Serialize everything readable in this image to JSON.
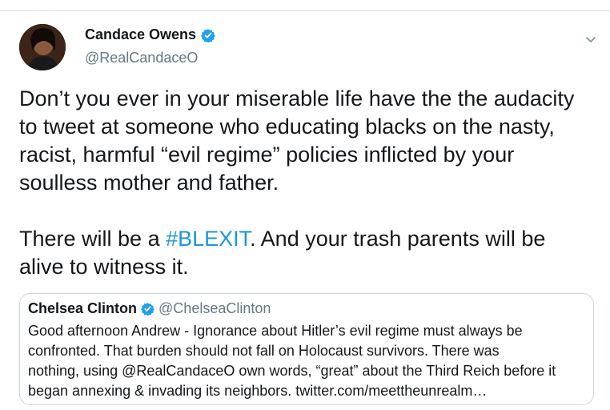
{
  "tweet": {
    "author_name": "Candace Owens",
    "author_handle": "@RealCandaceO",
    "body_lines": [
      "Don’t you ever in your miserable life have the the audacity",
      "to tweet at someone who educating blacks on the nasty,",
      "racist, harmful “evil regime” policies inflicted by your",
      "soulless mother and father."
    ],
    "second_para_line1_pre": "There will be a ",
    "hashtag": "#BLEXIT",
    "second_para_line1_post": ". And your trash parents will be",
    "second_para_line2": "alive to witness it."
  },
  "quoted_tweet": {
    "author_name": "Chelsea Clinton",
    "author_handle": "@ChelseaClinton",
    "text_lines": [
      "Good afternoon Andrew - Ignorance about Hitler’s evil regime must always be",
      "confronted. That burden should not fall on Holocaust survivors. There was",
      "nothing, using @RealCandaceO own words, “great” about the Third Reich before it",
      "began annexing & invading its neighbors. twitter.com/meettheunrealm…"
    ]
  },
  "colors": {
    "accent": "#1b95e0",
    "text": "#14171a",
    "secondary": "#657786",
    "border": "#ccd6dd"
  },
  "icons": [
    "verified-badge-icon",
    "chevron-down-icon"
  ]
}
